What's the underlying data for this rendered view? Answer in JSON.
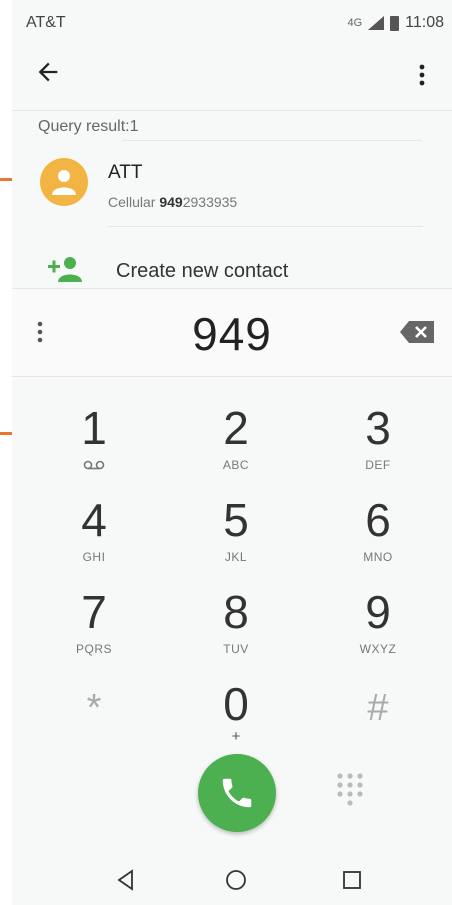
{
  "status_bar": {
    "carrier": "AT&T",
    "signal": "4G",
    "time": "11:08"
  },
  "search": {
    "result_label": "Query result:1"
  },
  "result": {
    "name": "ATT",
    "type": "Cellular",
    "number_match": "949",
    "number_rest": "2933935"
  },
  "create_contact": {
    "label": "Create new contact"
  },
  "dial": {
    "number": "949"
  },
  "keypad": [
    {
      "digit": "1",
      "letters": ""
    },
    {
      "digit": "2",
      "letters": "ABC"
    },
    {
      "digit": "3",
      "letters": "DEF"
    },
    {
      "digit": "4",
      "letters": "GHI"
    },
    {
      "digit": "5",
      "letters": "JKL"
    },
    {
      "digit": "6",
      "letters": "MNO"
    },
    {
      "digit": "7",
      "letters": "PQRS"
    },
    {
      "digit": "8",
      "letters": "TUV"
    },
    {
      "digit": "9",
      "letters": "WXYZ"
    },
    {
      "digit": "*",
      "letters": ""
    },
    {
      "digit": "0",
      "letters": "+"
    },
    {
      "digit": "#",
      "letters": ""
    }
  ],
  "colors": {
    "accent_call": "#4caf50",
    "avatar": "#f2b544",
    "callout": "#e8782f",
    "add_contact_icon": "#4caf50"
  },
  "icons": [
    "back-arrow-icon",
    "more-vert-icon",
    "person-icon",
    "add-person-icon",
    "backspace-icon",
    "voicemail-icon",
    "phone-icon",
    "dialpad-icon",
    "nav-back-icon",
    "nav-home-icon",
    "nav-recent-icon"
  ]
}
